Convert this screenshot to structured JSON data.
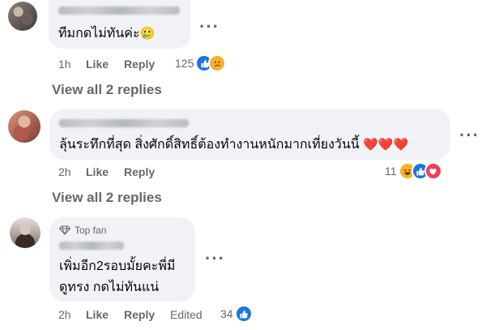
{
  "comments": [
    {
      "text": "ทีมกดไม่ทันค่ะ",
      "emoji": "🥲",
      "time": "1h",
      "like_label": "Like",
      "reply_label": "Reply",
      "reaction_count": "125",
      "reactions": [
        "like",
        "sad"
      ],
      "view_replies": "View all 2 replies"
    },
    {
      "text": "ลุ้นระทึกที่สุด สิ่งศักดิ์สิทธิ์ต้องทำงานหนักมากเที่ยงวันนี้",
      "emoji": "❤️❤️❤️",
      "time": "2h",
      "like_label": "Like",
      "reply_label": "Reply",
      "reaction_count": "11",
      "reactions": [
        "haha",
        "like",
        "love"
      ],
      "view_replies": "View all 2 replies"
    },
    {
      "badge": "Top fan",
      "line1": "เพิ่มอีก2รอบมั้ยคะพี่มี",
      "line2": "ดูทรง กดไม่ทันแน่",
      "time": "2h",
      "like_label": "Like",
      "reply_label": "Reply",
      "edited_label": "Edited",
      "reaction_count": "34",
      "reactions": [
        "like"
      ]
    }
  ],
  "more_options": "···",
  "colors": {
    "like": "#1b74e4",
    "love": "#f33e58",
    "haha": "#f7b125",
    "sad": "#f7b125",
    "bubble": "#f0f2f5",
    "meta": "#65676b"
  },
  "icons": {
    "diamond": "diamond-icon",
    "more": "more-options-icon"
  }
}
